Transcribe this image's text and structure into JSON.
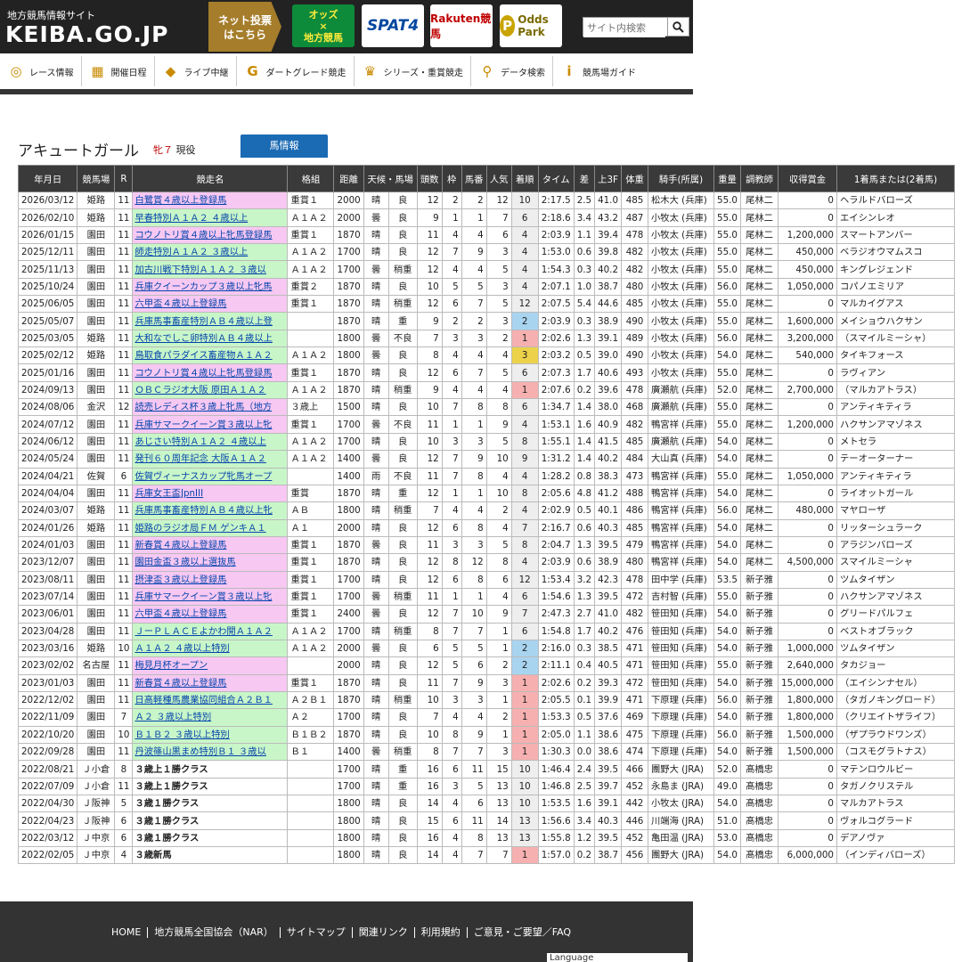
{
  "header": {
    "logo_sub": "地方競馬情報サイト",
    "logo_main": "KEIBA.GO.JP",
    "netvote_label": "ネット投票\nはこちら",
    "banners": {
      "b1_top": "オッズ",
      "b1_mid": "×",
      "b1_bottom": "地方競馬",
      "b2": "SPAT4",
      "b3": "Rakuten競馬",
      "b4": "Odds Park",
      "b4_glyph": "P"
    },
    "search_placeholder": "サイト内検索"
  },
  "nav": [
    {
      "label": "レース情報",
      "icon": "race-info-icon",
      "glyph": "◎"
    },
    {
      "label": "開催日程",
      "icon": "calendar-icon",
      "glyph": "▦"
    },
    {
      "label": "ライブ中継",
      "icon": "ticket-icon",
      "glyph": "◆"
    },
    {
      "label": "ダートグレード競走",
      "icon": "dirt-grade-icon",
      "glyph": "G"
    },
    {
      "label": "シリーズ・重賞競走",
      "icon": "trophy-icon",
      "glyph": "♛"
    },
    {
      "label": "データ検索",
      "icon": "search-icon",
      "glyph": "⚲"
    },
    {
      "label": "競馬場ガイド",
      "icon": "info-icon",
      "glyph": "i"
    }
  ],
  "horse": {
    "name": "アキュートガール",
    "sex_age": "牝７",
    "status": "現役",
    "tab_label": "馬情報"
  },
  "columns": [
    "年月日",
    "競馬場",
    "R",
    "競走名",
    "格組",
    "距離",
    "天候・馬場",
    "頭数",
    "枠",
    "馬番",
    "人気",
    "着順",
    "タイム",
    "差",
    "上3F",
    "体重",
    "騎手(所属)",
    "重量",
    "調教師",
    "収得賞金",
    "1着馬または(2着馬)"
  ],
  "rows": [
    [
      "2026/03/12",
      "姫路",
      "11",
      "白鷺賞４歳以上登録馬",
      "重賞１",
      "2000",
      "晴",
      "良",
      "12",
      "2",
      "2",
      "12",
      "10",
      "2:17.5",
      "2.5",
      "41.0",
      "485",
      "松木大 (兵庫)",
      "55.0",
      "尾林二",
      "0",
      "ヘラルドバローズ",
      "pink"
    ],
    [
      "2026/02/10",
      "姫路",
      "11",
      "早春特別Ａ１Ａ２ ４歳以上",
      "Ａ１Ａ２",
      "2000",
      "曇",
      "良",
      "9",
      "1",
      "1",
      "7",
      "6",
      "2:18.6",
      "3.4",
      "43.2",
      "487",
      "小牧太 (兵庫)",
      "55.0",
      "尾林二",
      "0",
      "エイシンレオ",
      "green"
    ],
    [
      "2026/01/15",
      "園田",
      "11",
      "コウノトリ賞４歳以上牝馬登録馬",
      "重賞１",
      "1870",
      "晴",
      "良",
      "11",
      "4",
      "4",
      "6",
      "4",
      "2:03.9",
      "1.1",
      "39.4",
      "478",
      "小牧太 (兵庫)",
      "55.0",
      "尾林二",
      "1,200,000",
      "スマートアンバー",
      "pink"
    ],
    [
      "2025/12/11",
      "園田",
      "11",
      "師走特別Ａ１Ａ２ ３歳以上",
      "Ａ１Ａ２",
      "1700",
      "晴",
      "良",
      "12",
      "7",
      "9",
      "3",
      "4",
      "1:53.0",
      "0.6",
      "39.8",
      "482",
      "小牧太 (兵庫)",
      "55.0",
      "尾林二",
      "450,000",
      "ベラジオウマムスコ",
      "green"
    ],
    [
      "2025/11/13",
      "園田",
      "11",
      "加古川戦下特別Ａ１Ａ２ ３歳以",
      "Ａ１Ａ２",
      "1700",
      "曇",
      "稍重",
      "12",
      "4",
      "4",
      "5",
      "4",
      "1:54.3",
      "0.3",
      "40.2",
      "482",
      "小牧太 (兵庫)",
      "55.0",
      "尾林二",
      "450,000",
      "キングレジェンド",
      "green"
    ],
    [
      "2025/10/24",
      "園田",
      "11",
      "兵庫クイーンカップ３歳以上牝馬",
      "重賞２",
      "1870",
      "晴",
      "良",
      "10",
      "5",
      "5",
      "3",
      "4",
      "2:07.1",
      "1.0",
      "38.7",
      "480",
      "小牧太 (兵庫)",
      "56.0",
      "尾林二",
      "1,050,000",
      "コパノエミリア",
      "pink"
    ],
    [
      "2025/06/05",
      "園田",
      "11",
      "六甲盃４歳以上登録馬",
      "重賞１",
      "1870",
      "晴",
      "稍重",
      "12",
      "6",
      "7",
      "5",
      "12",
      "2:07.5",
      "5.4",
      "44.6",
      "485",
      "小牧太 (兵庫)",
      "55.0",
      "尾林二",
      "0",
      "マルカイグアス",
      "pink"
    ],
    [
      "2025/05/07",
      "園田",
      "11",
      "兵庫馬事畜産特別ＡＢ４歳以上登",
      "",
      "1870",
      "晴",
      "重",
      "9",
      "2",
      "2",
      "3",
      "2",
      "2:03.9",
      "0.3",
      "38.9",
      "490",
      "小牧太 (兵庫)",
      "55.0",
      "尾林二",
      "1,600,000",
      "メイショウハクサン",
      "green"
    ],
    [
      "2025/03/05",
      "姫路",
      "11",
      "大和なでしこ卵特別ＡＢ４歳以上",
      "",
      "1800",
      "曇",
      "不良",
      "7",
      "3",
      "3",
      "2",
      "1",
      "2:02.6",
      "1.3",
      "39.1",
      "489",
      "小牧太 (兵庫)",
      "56.0",
      "尾林二",
      "3,200,000",
      "（スマイルミーシャ）",
      "green"
    ],
    [
      "2025/02/12",
      "姫路",
      "11",
      "鳥取食パラダイス畜産物Ａ１Ａ２",
      "Ａ１Ａ２",
      "1800",
      "曇",
      "良",
      "8",
      "4",
      "4",
      "4",
      "3",
      "2:03.2",
      "0.5",
      "39.0",
      "490",
      "小牧太 (兵庫)",
      "54.0",
      "尾林二",
      "540,000",
      "タイキフォース",
      "green"
    ],
    [
      "2025/01/16",
      "園田",
      "11",
      "コウノトリ賞４歳以上牝馬登録馬",
      "重賞１",
      "1870",
      "晴",
      "良",
      "12",
      "6",
      "7",
      "5",
      "6",
      "2:07.3",
      "1.7",
      "40.6",
      "493",
      "小牧太 (兵庫)",
      "55.0",
      "尾林二",
      "0",
      "ラヴィアン",
      "pink"
    ],
    [
      "2024/09/13",
      "園田",
      "11",
      "ＯＢＣラジオ大阪 原田Ａ１Ａ２",
      "Ａ１Ａ２",
      "1870",
      "晴",
      "稍重",
      "9",
      "4",
      "4",
      "4",
      "1",
      "2:07.6",
      "0.2",
      "39.6",
      "478",
      "廣瀬航 (兵庫)",
      "52.0",
      "尾林二",
      "2,700,000",
      "（マルカアトラス）",
      "green"
    ],
    [
      "2024/08/06",
      "金沢",
      "12",
      "読売レディス杯３歳上牝馬（地方",
      "３歳上",
      "1500",
      "晴",
      "良",
      "10",
      "7",
      "8",
      "8",
      "6",
      "1:34.7",
      "1.4",
      "38.0",
      "468",
      "廣瀬航 (兵庫)",
      "55.0",
      "尾林二",
      "0",
      "アンティキティラ",
      "pink"
    ],
    [
      "2024/07/12",
      "園田",
      "11",
      "兵庫サマークイーン賞３歳以上牝",
      "重賞１",
      "1700",
      "曇",
      "不良",
      "11",
      "1",
      "1",
      "9",
      "4",
      "1:53.1",
      "1.6",
      "40.9",
      "482",
      "鴨宮祥 (兵庫)",
      "55.0",
      "尾林二",
      "1,200,000",
      "ハクサンアマゾネス",
      "pink"
    ],
    [
      "2024/06/12",
      "園田",
      "11",
      "あじさい特別Ａ１Ａ２ ４歳以上",
      "Ａ１Ａ２",
      "1700",
      "晴",
      "良",
      "10",
      "3",
      "3",
      "5",
      "8",
      "1:55.1",
      "1.4",
      "41.5",
      "485",
      "廣瀬航 (兵庫)",
      "54.0",
      "尾林二",
      "0",
      "メトセラ",
      "green"
    ],
    [
      "2024/05/24",
      "園田",
      "11",
      "発刊６０周年記念 大阪Ａ１Ａ２",
      "Ａ１Ａ２",
      "1400",
      "曇",
      "良",
      "12",
      "7",
      "9",
      "10",
      "9",
      "1:31.2",
      "1.4",
      "40.2",
      "484",
      "大山真 (兵庫)",
      "54.0",
      "尾林二",
      "0",
      "テーオーターナー",
      "green"
    ],
    [
      "2024/04/21",
      "佐賀",
      "6",
      "佐賀ヴィーナスカップ牝馬オープ",
      "",
      "1400",
      "雨",
      "不良",
      "11",
      "7",
      "8",
      "4",
      "4",
      "1:28.2",
      "0.8",
      "38.3",
      "473",
      "鴨宮祥 (兵庫)",
      "55.0",
      "尾林二",
      "1,050,000",
      "アンティキティラ",
      "green"
    ],
    [
      "2024/04/04",
      "園田",
      "11",
      "兵庫女王盃JpnIII",
      "重賞",
      "1870",
      "晴",
      "重",
      "12",
      "1",
      "1",
      "10",
      "8",
      "2:05.6",
      "4.8",
      "41.2",
      "488",
      "鴨宮祥 (兵庫)",
      "54.0",
      "尾林二",
      "0",
      "ライオットガール",
      "pink"
    ],
    [
      "2024/03/07",
      "姫路",
      "11",
      "兵庫馬事畜産特別ＡＢ４歳以上牝",
      "ＡＢ",
      "1800",
      "晴",
      "稍重",
      "7",
      "4",
      "4",
      "2",
      "4",
      "2:02.9",
      "0.5",
      "40.1",
      "486",
      "鴨宮祥 (兵庫)",
      "56.0",
      "尾林二",
      "480,000",
      "マヤローザ",
      "green"
    ],
    [
      "2024/01/26",
      "姫路",
      "11",
      "姫路のラジオ局ＦＭ ゲンキＡ１",
      "Ａ１",
      "2000",
      "晴",
      "良",
      "12",
      "6",
      "8",
      "4",
      "7",
      "2:16.7",
      "0.6",
      "40.3",
      "485",
      "鴨宮祥 (兵庫)",
      "54.0",
      "尾林二",
      "0",
      "リッターシュラーク",
      "green"
    ],
    [
      "2024/01/03",
      "園田",
      "11",
      "新春賞４歳以上登録馬",
      "重賞１",
      "1870",
      "曇",
      "良",
      "11",
      "3",
      "3",
      "5",
      "8",
      "2:04.7",
      "1.3",
      "39.5",
      "479",
      "鴨宮祥 (兵庫)",
      "54.0",
      "尾林二",
      "0",
      "アラジンバローズ",
      "pink"
    ],
    [
      "2023/12/07",
      "園田",
      "11",
      "園田金盃３歳以上選抜馬",
      "重賞１",
      "1870",
      "晴",
      "良",
      "12",
      "8",
      "12",
      "8",
      "4",
      "2:03.9",
      "0.6",
      "38.9",
      "480",
      "鴨宮祥 (兵庫)",
      "54.0",
      "尾林二",
      "4,500,000",
      "スマイルミーシャ",
      "pink"
    ],
    [
      "2023/08/11",
      "園田",
      "11",
      "摂津盃３歳以上登録馬",
      "重賞１",
      "1700",
      "晴",
      "良",
      "12",
      "6",
      "8",
      "6",
      "12",
      "1:53.4",
      "3.2",
      "42.3",
      "478",
      "田中学 (兵庫)",
      "53.5",
      "新子雅",
      "0",
      "ツムタイザン",
      "pink"
    ],
    [
      "2023/07/14",
      "園田",
      "11",
      "兵庫サマークイーン賞３歳以上牝",
      "重賞１",
      "1700",
      "曇",
      "稍重",
      "11",
      "1",
      "1",
      "4",
      "6",
      "1:54.6",
      "1.3",
      "39.5",
      "472",
      "吉村智 (兵庫)",
      "55.0",
      "新子雅",
      "0",
      "ハクサンアマゾネス",
      "pink"
    ],
    [
      "2023/06/01",
      "園田",
      "11",
      "六甲盃４歳以上登録馬",
      "重賞１",
      "2400",
      "曇",
      "良",
      "12",
      "7",
      "10",
      "9",
      "7",
      "2:47.3",
      "2.7",
      "41.0",
      "482",
      "笹田知 (兵庫)",
      "54.0",
      "新子雅",
      "0",
      "グリードパルフェ",
      "pink"
    ],
    [
      "2023/04/28",
      "園田",
      "11",
      "ＪーＰＬＡＣＥよかわ開Ａ１Ａ２",
      "Ａ１Ａ２",
      "1700",
      "晴",
      "稍重",
      "8",
      "7",
      "7",
      "1",
      "6",
      "1:54.8",
      "1.7",
      "40.2",
      "476",
      "笹田知 (兵庫)",
      "54.0",
      "新子雅",
      "0",
      "ベストオブラック",
      "green"
    ],
    [
      "2023/03/16",
      "姫路",
      "10",
      "Ａ１Ａ２ ４歳以上特別",
      "Ａ１Ａ２",
      "2000",
      "曇",
      "良",
      "6",
      "5",
      "5",
      "1",
      "2",
      "2:16.0",
      "0.3",
      "38.5",
      "471",
      "笹田知 (兵庫)",
      "54.0",
      "新子雅",
      "1,000,000",
      "ツムタイザン",
      "green"
    ],
    [
      "2023/02/02",
      "名古屋",
      "11",
      "梅見月杯オープン",
      "",
      "2000",
      "晴",
      "良",
      "12",
      "5",
      "6",
      "2",
      "2",
      "2:11.1",
      "0.4",
      "40.5",
      "471",
      "笹田知 (兵庫)",
      "55.0",
      "新子雅",
      "2,640,000",
      "タカジョー",
      "pink"
    ],
    [
      "2023/01/03",
      "園田",
      "11",
      "新春賞４歳以上登録馬",
      "重賞１",
      "1870",
      "晴",
      "良",
      "11",
      "7",
      "9",
      "3",
      "1",
      "2:02.6",
      "0.2",
      "39.3",
      "472",
      "笹田知 (兵庫)",
      "54.0",
      "新子雅",
      "15,000,000",
      "（エイシンナセル）",
      "pink"
    ],
    [
      "2022/12/02",
      "園田",
      "11",
      "日高軽種馬農業協同組合Ａ２Ｂ１",
      "Ａ２Ｂ１",
      "1870",
      "晴",
      "稍重",
      "10",
      "3",
      "3",
      "1",
      "1",
      "2:05.5",
      "0.1",
      "39.9",
      "471",
      "下原理 (兵庫)",
      "56.0",
      "新子雅",
      "1,800,000",
      "（タガノキングロード）",
      "green"
    ],
    [
      "2022/11/09",
      "園田",
      "7",
      "Ａ２ ３歳以上特別",
      "Ａ２",
      "1700",
      "晴",
      "良",
      "7",
      "4",
      "4",
      "2",
      "1",
      "1:53.3",
      "0.5",
      "37.6",
      "469",
      "下原理 (兵庫)",
      "54.0",
      "新子雅",
      "1,800,000",
      "（クリエイトザライフ）",
      "green"
    ],
    [
      "2022/10/20",
      "園田",
      "10",
      "Ｂ１Ｂ２ ３歳以上特別",
      "Ｂ１Ｂ２",
      "1870",
      "晴",
      "良",
      "10",
      "8",
      "9",
      "1",
      "1",
      "2:05.0",
      "1.1",
      "38.6",
      "475",
      "下原理 (兵庫)",
      "56.0",
      "新子雅",
      "1,500,000",
      "（ザプラウドワンズ）",
      "green"
    ],
    [
      "2022/09/28",
      "園田",
      "11",
      "丹波篠山黒まめ特別Ｂ１ ３歳以",
      "Ｂ１",
      "1400",
      "曇",
      "稍重",
      "8",
      "7",
      "7",
      "3",
      "1",
      "1:30.3",
      "0.0",
      "38.6",
      "474",
      "下原理 (兵庫)",
      "54.0",
      "新子雅",
      "1,500,000",
      "（コスモグラトナス）",
      "green"
    ],
    [
      "2022/08/21",
      "Ｊ小倉",
      "8",
      "３歳上１勝クラス",
      "",
      "1700",
      "晴",
      "重",
      "16",
      "6",
      "11",
      "15",
      "10",
      "1:46.4",
      "2.4",
      "39.5",
      "466",
      "團野大 (JRA)",
      "52.0",
      "髙橋忠",
      "0",
      "マテンロウルビー",
      "plain"
    ],
    [
      "2022/07/09",
      "Ｊ小倉",
      "11",
      "３歳上１勝クラス",
      "",
      "1700",
      "晴",
      "重",
      "16",
      "3",
      "5",
      "13",
      "10",
      "1:46.8",
      "2.5",
      "39.7",
      "452",
      "永島ま (JRA)",
      "49.0",
      "髙橋忠",
      "0",
      "タガノクリステル",
      "plain"
    ],
    [
      "2022/04/30",
      "Ｊ阪神",
      "5",
      "３歳１勝クラス",
      "",
      "1800",
      "晴",
      "良",
      "14",
      "4",
      "6",
      "13",
      "10",
      "1:53.5",
      "1.6",
      "39.1",
      "442",
      "小牧太 (JRA)",
      "54.0",
      "髙橋忠",
      "0",
      "マルカアトラス",
      "plain"
    ],
    [
      "2022/04/23",
      "Ｊ阪神",
      "6",
      "３歳１勝クラス",
      "",
      "1800",
      "晴",
      "良",
      "15",
      "6",
      "11",
      "14",
      "13",
      "1:56.6",
      "3.4",
      "40.3",
      "446",
      "川端海 (JRA)",
      "51.0",
      "髙橋忠",
      "0",
      "ヴォルコグラード",
      "plain"
    ],
    [
      "2022/03/12",
      "Ｊ中京",
      "6",
      "３歳１勝クラス",
      "",
      "1800",
      "晴",
      "良",
      "16",
      "4",
      "8",
      "13",
      "13",
      "1:55.8",
      "1.2",
      "39.5",
      "452",
      "亀田温 (JRA)",
      "53.0",
      "髙橋忠",
      "0",
      "デアノヴァ",
      "plain"
    ],
    [
      "2022/02/05",
      "Ｊ中京",
      "4",
      "３歳新馬",
      "",
      "1800",
      "晴",
      "良",
      "14",
      "4",
      "7",
      "7",
      "1",
      "1:57.0",
      "0.2",
      "38.7",
      "456",
      "團野大 (JRA)",
      "54.0",
      "髙橋忠",
      "6,000,000",
      "（インディバローズ）",
      "plain"
    ]
  ],
  "footer": {
    "links": [
      "HOME",
      "地方競馬全国協会（NAR）",
      "サイトマップ",
      "関連リンク",
      "利用規約",
      "ご意見・ご要望／FAQ"
    ],
    "language": "Language"
  }
}
